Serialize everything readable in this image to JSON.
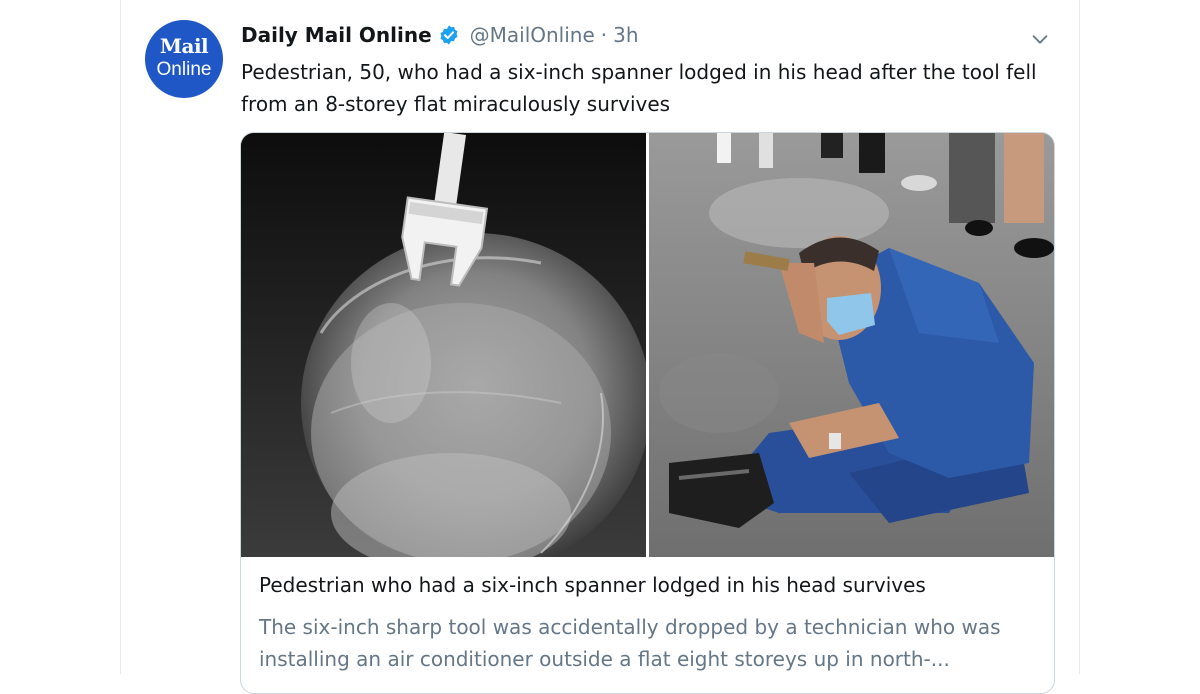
{
  "tweet": {
    "display_name": "Daily Mail Online",
    "handle": "@MailOnline",
    "separator": "·",
    "time": "3h",
    "text": "Pedestrian, 50, who had a six-inch spanner lodged in his head after the tool fell from an 8-storey flat miraculously survives",
    "avatar": {
      "line1": "Mail",
      "line2": "Online",
      "color": "#1f57c7"
    },
    "verified": true
  },
  "card": {
    "title": "Pedestrian who had a six-inch spanner lodged in his head survives",
    "description": "The six-inch sharp tool was accidentally dropped by a technician who was installing an air conditioner outside a flat eight storeys up in north-..."
  },
  "colors": {
    "verified_blue": "#1da1f2",
    "secondary_text": "#657786",
    "primary_text": "#14171a",
    "border": "#ccd6dd"
  },
  "icons": [
    "verified-badge-icon",
    "chevron-down-icon"
  ]
}
